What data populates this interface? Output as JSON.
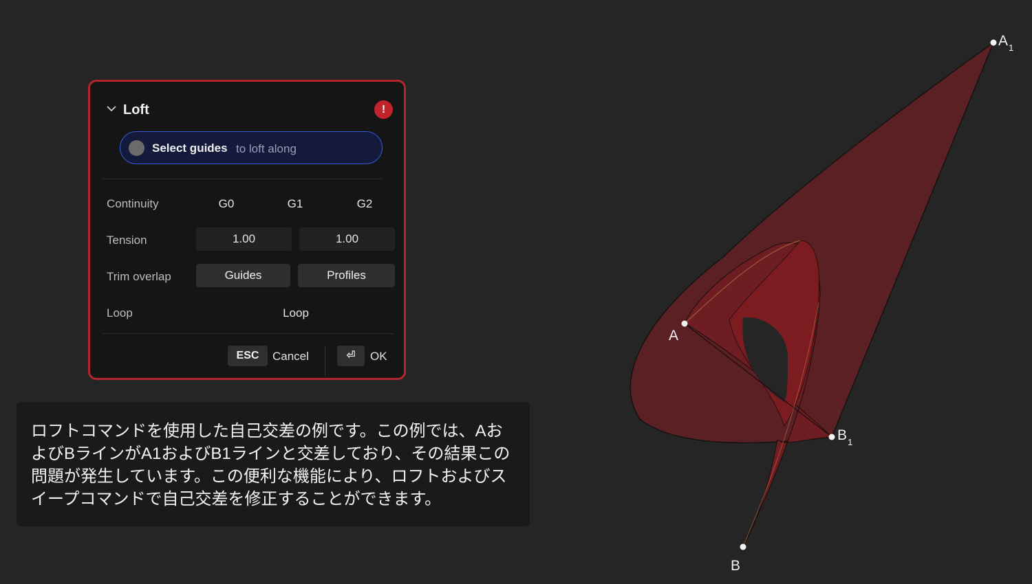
{
  "loft_panel": {
    "title": "Loft",
    "alert_symbol": "!",
    "selector": {
      "strong": "Select guides",
      "hint": "to loft along"
    },
    "continuity": {
      "label": "Continuity",
      "options": [
        "G0",
        "G1",
        "G2"
      ]
    },
    "tension": {
      "label": "Tension",
      "values": [
        "1.00",
        "1.00"
      ]
    },
    "trim_overlap": {
      "label": "Trim overlap",
      "options": [
        "Guides",
        "Profiles"
      ]
    },
    "loop": {
      "label": "Loop",
      "value": "Loop"
    },
    "footer": {
      "esc_key": "ESC",
      "cancel": "Cancel",
      "enter_key": "⏎",
      "ok": "OK"
    }
  },
  "caption": {
    "text": "ロフトコマンドを使用した自己交差の例です。この例では、AおよびBラインがA1およびB1ラインと交差しており、その結果この問題が発生しています。この便利な機能により、ロフトおよびスイープコマンドで自己交差を修正することができます。"
  },
  "drawing": {
    "points": {
      "A": {
        "label": "A",
        "sub": ""
      },
      "A1": {
        "label": "A",
        "sub": "1"
      },
      "B": {
        "label": "B",
        "sub": ""
      },
      "B1": {
        "label": "B",
        "sub": "1"
      }
    },
    "colors": {
      "surface": "#5a2024",
      "surface_inner": "#7d1c20",
      "accent": "#b3262c"
    }
  }
}
